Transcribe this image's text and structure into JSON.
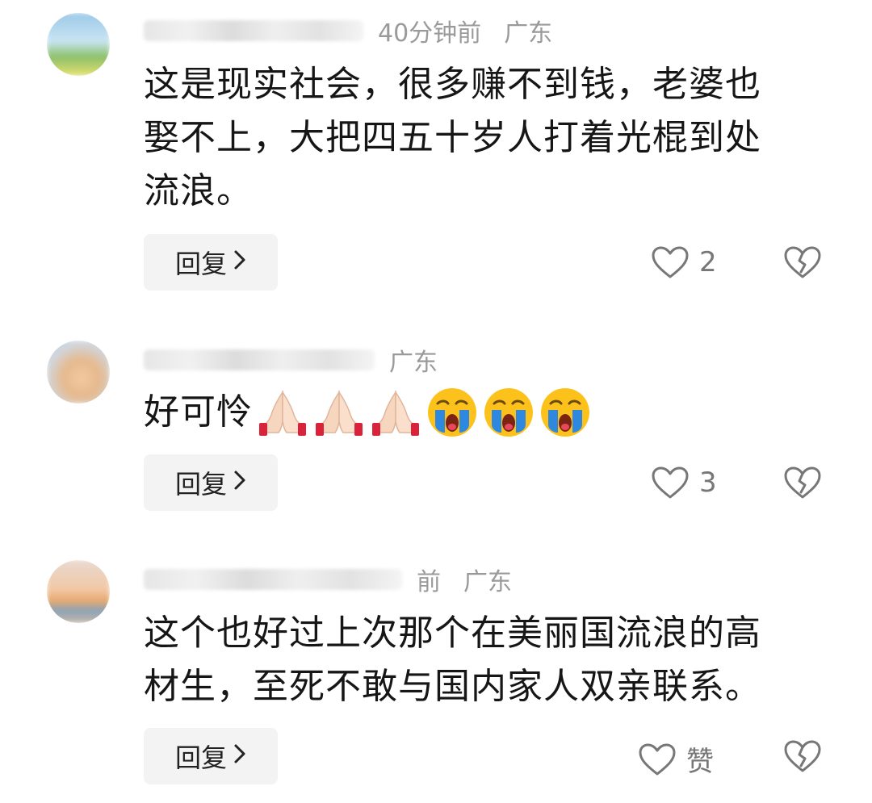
{
  "comments": [
    {
      "time": "40分钟前",
      "location": "广东",
      "text_lines": [
        "这是现实社会，很多赚不到钱，老婆也",
        "娶不上，大把四五十岁人打着光棍到处",
        "流浪。"
      ],
      "reply_label": "回复",
      "like_count": "2"
    },
    {
      "time": "",
      "location": "广东",
      "text": "好可怜",
      "emojis": [
        "folded-hands",
        "folded-hands",
        "folded-hands",
        "crying-face",
        "crying-face",
        "crying-face"
      ],
      "reply_label": "回复",
      "like_count": "3"
    },
    {
      "time": "前",
      "location": "广东",
      "text_lines": [
        "这个也好过上次那个在美丽国流浪的高",
        "材生，至死不敢与国内家人双亲联系。"
      ],
      "reply_label": "回复",
      "like_count": "赞"
    }
  ],
  "icons": {
    "reply_chevron": "chevron-right-icon",
    "like": "heart-outline-icon",
    "dislike": "broken-heart-icon"
  },
  "colors": {
    "meta_text": "#9a9a9a",
    "body_text": "#161616",
    "reply_bg": "#f3f3f3",
    "icon": "#777777"
  }
}
